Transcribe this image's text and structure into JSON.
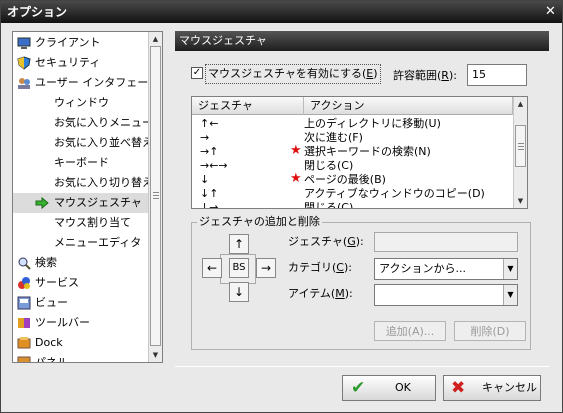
{
  "window": {
    "title": "オプション",
    "close_glyph": "✕"
  },
  "sidebar": {
    "items": [
      {
        "label": "クライアント",
        "icon": "monitor-icon",
        "indent": 0
      },
      {
        "label": "セキュリティ",
        "icon": "shield-icon",
        "indent": 0
      },
      {
        "label": "ユーザー インタフェース",
        "icon": "users-icon",
        "indent": 0
      },
      {
        "label": "ウィンドウ",
        "icon": "",
        "indent": 1
      },
      {
        "label": "お気に入りメニュー",
        "icon": "",
        "indent": 1
      },
      {
        "label": "お気に入り並べ替え",
        "icon": "",
        "indent": 1
      },
      {
        "label": "キーボード",
        "icon": "",
        "indent": 1
      },
      {
        "label": "お気に入り切り替え",
        "icon": "",
        "indent": 1
      },
      {
        "label": "マウスジェスチャ",
        "icon": "green-arrow-icon",
        "indent": 1,
        "selected": true
      },
      {
        "label": "マウス割り当て",
        "icon": "",
        "indent": 1
      },
      {
        "label": "メニューエディタ",
        "icon": "",
        "indent": 1
      },
      {
        "label": "検索",
        "icon": "magnifier-icon",
        "indent": 0
      },
      {
        "label": "サービス",
        "icon": "services-icon",
        "indent": 0
      },
      {
        "label": "ビュー",
        "icon": "view-icon",
        "indent": 0
      },
      {
        "label": "ツールバー",
        "icon": "toolbar-icon",
        "indent": 0
      },
      {
        "label": "Dock",
        "icon": "dock-icon",
        "indent": 0
      },
      {
        "label": "パネル",
        "icon": "panel-icon",
        "indent": 0
      }
    ]
  },
  "panel": {
    "title": "マウスジェスチャ",
    "enable_checkbox": {
      "label": "マウスジェスチャを有効にする(",
      "accel": "E",
      "suffix": ")",
      "checked": true
    },
    "tolerance": {
      "label": "許容範囲(",
      "accel": "R",
      "suffix": "):",
      "value": "15"
    },
    "list": {
      "columns": [
        "ジェスチャ",
        "アクション"
      ],
      "rows": [
        {
          "gesture": "↑←",
          "action": "上のディレクトリに移動(U)",
          "star": false
        },
        {
          "gesture": "→",
          "action": "次に進む(F)",
          "star": false
        },
        {
          "gesture": "→↑",
          "action": "選択キーワードの検索(N)",
          "star": true
        },
        {
          "gesture": "→←→",
          "action": "閉じる(C)",
          "star": false
        },
        {
          "gesture": "↓",
          "action": "ページの最後(B)",
          "star": true
        },
        {
          "gesture": "↓↑",
          "action": "アクティブなウィンドウのコピー(D)",
          "star": false
        },
        {
          "gesture": "↓→",
          "action": "閉じる(C)",
          "star": false
        }
      ]
    },
    "group": {
      "label": "ジェスチャの追加と削除",
      "dir_up": "↑",
      "dir_down": "↓",
      "dir_left": "←",
      "dir_right": "→",
      "dir_bs": "BS",
      "gesture_label": "ジェスチャ(",
      "gesture_accel": "G",
      "gesture_suffix": "):",
      "category_label": "カテゴリ(",
      "category_accel": "C",
      "category_suffix": "):",
      "category_value": "アクションから...",
      "item_label": "アイテム(",
      "item_accel": "M",
      "item_suffix": "):",
      "add_label": "追加(A)...",
      "delete_label": "削除(D)"
    }
  },
  "footer": {
    "ok_label": "OK",
    "cancel_label": "キャンセル"
  },
  "colors": {
    "star": "#e01010",
    "ok_check": "#2e9a2e",
    "cancel_x": "#d02020"
  }
}
